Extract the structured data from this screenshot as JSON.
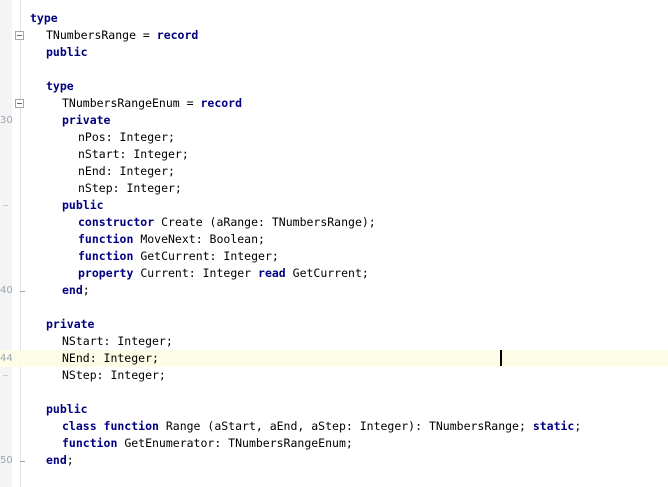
{
  "colors": {
    "keyword": "#000080",
    "text": "#000000",
    "current_line": "#fdfce6",
    "gutter": "#f4f4f4",
    "line_number": "#9aa6b4"
  },
  "gutter_labels": {
    "line_30": "30",
    "line_40": "40",
    "line_44": "44",
    "line_50": "50"
  },
  "lines": [
    {
      "indent": 0,
      "tokens": [
        [
          "kw",
          "type"
        ]
      ]
    },
    {
      "indent": 1,
      "fold": "open",
      "tokens": [
        [
          "id",
          "TNumbersRange = "
        ],
        [
          "kw",
          "record"
        ]
      ]
    },
    {
      "indent": 1,
      "tokens": [
        [
          "kw",
          "public"
        ]
      ]
    },
    {
      "indent": 0,
      "tokens": []
    },
    {
      "indent": 1,
      "tokens": [
        [
          "kw",
          "type"
        ]
      ]
    },
    {
      "indent": 2,
      "fold": "open",
      "tokens": [
        [
          "id",
          "TNumbersRangeEnum = "
        ],
        [
          "kw",
          "record"
        ]
      ]
    },
    {
      "indent": 2,
      "label": "30",
      "tokens": [
        [
          "kw",
          "private"
        ]
      ]
    },
    {
      "indent": 3,
      "tokens": [
        [
          "id",
          "nPos: Integer;"
        ]
      ]
    },
    {
      "indent": 3,
      "tokens": [
        [
          "id",
          "nStart: Integer;"
        ]
      ]
    },
    {
      "indent": 3,
      "tokens": [
        [
          "id",
          "nEnd: Integer;"
        ]
      ]
    },
    {
      "indent": 3,
      "tokens": [
        [
          "id",
          "nStep: Integer;"
        ]
      ]
    },
    {
      "indent": 2,
      "tick": true,
      "tokens": [
        [
          "kw",
          "public"
        ]
      ]
    },
    {
      "indent": 3,
      "tokens": [
        [
          "kw",
          "constructor"
        ],
        [
          "id",
          " Create (aRange: TNumbersRange);"
        ]
      ]
    },
    {
      "indent": 3,
      "tokens": [
        [
          "kw",
          "function"
        ],
        [
          "id",
          " MoveNext: Boolean;"
        ]
      ]
    },
    {
      "indent": 3,
      "tokens": [
        [
          "kw",
          "function"
        ],
        [
          "id",
          " GetCurrent: Integer;"
        ]
      ]
    },
    {
      "indent": 3,
      "tokens": [
        [
          "kw",
          "property"
        ],
        [
          "id",
          " Current: Integer "
        ],
        [
          "kw",
          "read"
        ],
        [
          "id",
          " GetCurrent;"
        ]
      ]
    },
    {
      "indent": 2,
      "label": "40",
      "fold": "end",
      "tokens": [
        [
          "kw",
          "end"
        ],
        [
          "id",
          ";"
        ]
      ]
    },
    {
      "indent": 0,
      "tokens": []
    },
    {
      "indent": 1,
      "tokens": [
        [
          "kw",
          "private"
        ]
      ]
    },
    {
      "indent": 2,
      "tokens": [
        [
          "id",
          "NStart: Integer;"
        ]
      ]
    },
    {
      "indent": 2,
      "label": "44",
      "current": true,
      "tokens": [
        [
          "id",
          "NEnd: Integer;"
        ]
      ]
    },
    {
      "indent": 2,
      "tick": true,
      "tokens": [
        [
          "id",
          "NStep: Integer;"
        ]
      ]
    },
    {
      "indent": 0,
      "tokens": []
    },
    {
      "indent": 1,
      "tokens": [
        [
          "kw",
          "public"
        ]
      ]
    },
    {
      "indent": 2,
      "tokens": [
        [
          "kw",
          "class function"
        ],
        [
          "id",
          " Range (aStart, aEnd, aStep: Integer): TNumbersRange; "
        ],
        [
          "kw",
          "static"
        ],
        [
          "id",
          ";"
        ]
      ]
    },
    {
      "indent": 2,
      "tokens": [
        [
          "kw",
          "function"
        ],
        [
          "id",
          " GetEnumerator: TNumbersRangeEnum;"
        ]
      ]
    },
    {
      "indent": 1,
      "label": "50",
      "fold": "end",
      "tokens": [
        [
          "kw",
          "end"
        ],
        [
          "id",
          ";"
        ]
      ]
    }
  ]
}
